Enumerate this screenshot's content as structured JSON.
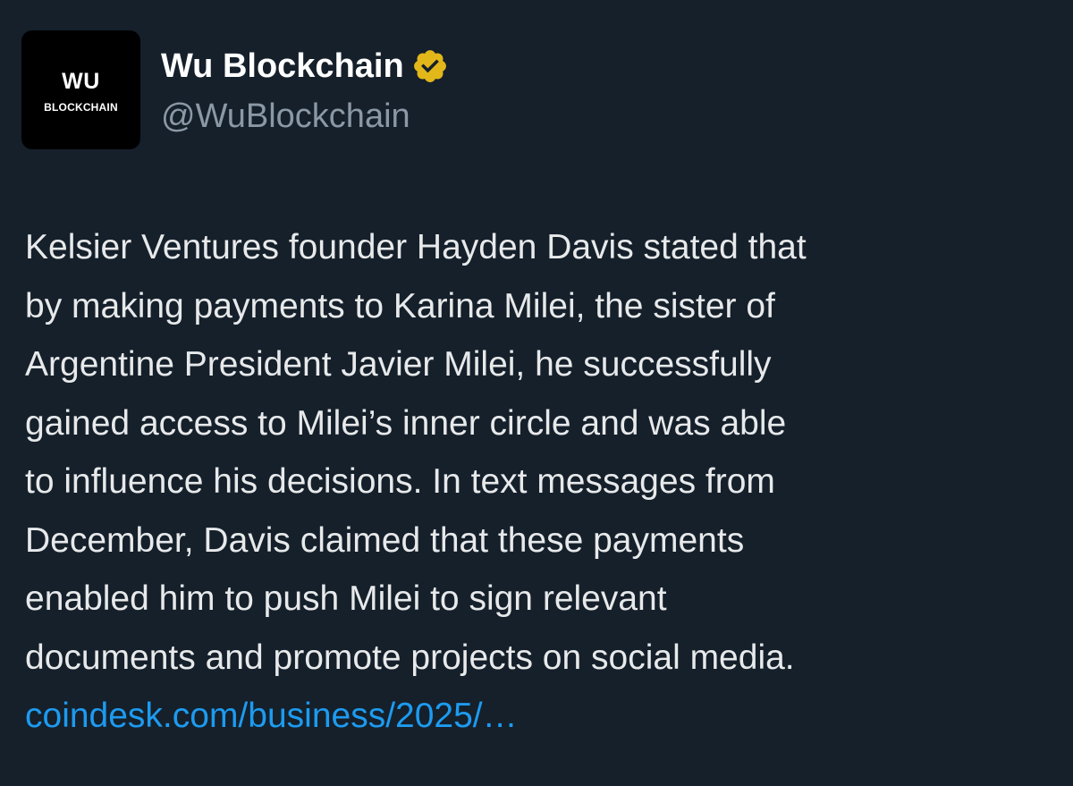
{
  "author": {
    "avatar": {
      "logo_text": "WU",
      "logo_subtext": "BLOCKCHAIN",
      "background": "#000000"
    },
    "display_name": "Wu Blockchain",
    "handle": "@WuBlockchain",
    "verified_icon": "verified-gold-badge-icon",
    "verified_color": "#e2b719"
  },
  "tweet": {
    "lines": [
      "Kelsier Ventures founder Hayden Davis stated that",
      "by making payments to Karina Milei, the sister of",
      "Argentine President Javier Milei, he successfully",
      "gained access to Milei’s inner circle and was able",
      "to influence his decisions. In text messages from",
      "December, Davis claimed that these payments",
      "enabled him to push Milei to sign relevant",
      "documents and promote projects on social media."
    ],
    "link_text": "coindesk.com/business/2025/…",
    "link_color": "#1d9bf0"
  },
  "theme": {
    "background": "#15202b",
    "text_primary": "#e7e9ea",
    "text_secondary": "#8b98a5"
  }
}
